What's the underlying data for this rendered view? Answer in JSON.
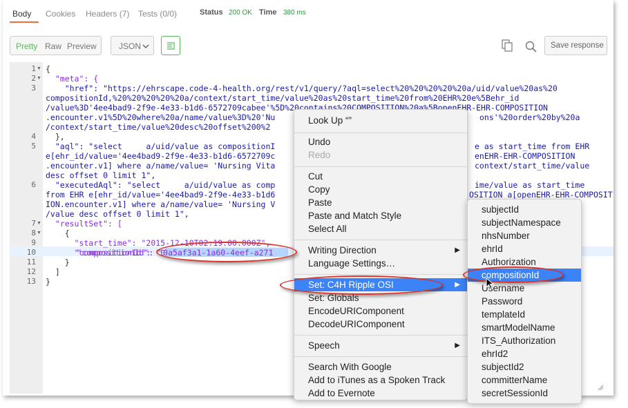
{
  "tabs": [
    {
      "label": "Body"
    },
    {
      "label": "Cookies"
    },
    {
      "label": "Headers (7)"
    },
    {
      "label": "Tests (0/0)"
    }
  ],
  "status": {
    "status_label": "Status",
    "status_value": "200 OK",
    "time_label": "Time",
    "time_value": "380 ms"
  },
  "toolbar": {
    "pretty": "Pretty",
    "raw": "Raw",
    "preview": "Preview",
    "format": "JSON",
    "save": "Save response"
  },
  "code_lines": [
    "{",
    "  \"meta\": {",
    "    \"href\": \"https://ehrscape.code-4-health.org/rest/v1/query/?aql=select%20%20%20%20%20a/uid/value%20as%20",
    "compositionId,%20%20%20%20%20a/context/start_time/value%20as%20start_time%20from%20EHR%20e%5Behr_id",
    "/value%3D'4ee4bad9-2f9e-4e33-b1d6-6572709cabee'%5D%20contains%20COMPOSITION%20a%5BopenEHR-EHR-COMPOSITION",
    ".encounter.v1%5D%20where%20a/name/value%3D%20'Nu",
    "/context/start_time/value%20desc%20offset%200%2",
    "  },",
    "  \"aql\": \"select     a/uid/value as compositionI",
    "e[ehr_id/value='4ee4bad9-2f9e-4e33-b1d6-6572709c",
    ".encounter.v1] where a/name/value= 'Nursing Vita",
    "desc offset 0 limit 1\",",
    "  \"executedAql\": \"select     a/uid/value as comp",
    "from EHR e[ehr_id/value='4ee4bad9-2f9e-4e33-b1d6",
    "ION.encounter.v1] where a/name/value= 'Nursing V",
    "/value desc offset 0 limit 1\",",
    "  \"resultSet\": [",
    "    {",
    "      \"start_time\": \"2015-12-10T02:19:00.000Z\",",
    "      \"compositionId\": \"0a5af3a1-1a60-4eef-a271",
    "    }",
    "  ]",
    "}"
  ],
  "code_right": [
    "ons'%20order%20by%20a",
    "e as start_time from EHR",
    "enEHR-EHR-COMPOSITION",
    "context/start_time/value",
    "ime/value as start_time",
    "OSITION a[openEHR-EHR-COMPOSIT"
  ],
  "line_numbers": [
    "1",
    "2",
    "3",
    "4",
    "5",
    "6",
    "7",
    "8",
    "9",
    "10",
    "11",
    "12",
    "13"
  ],
  "context_menu": {
    "items": [
      "Look Up “”",
      "Undo",
      "Redo",
      "Cut",
      "Copy",
      "Paste",
      "Paste and Match Style",
      "Select All",
      "Writing Direction",
      "Language Settings…",
      "Set: C4H Ripple OSI",
      "Set: Globals",
      "EncodeURIComponent",
      "DecodeURIComponent",
      "Speech",
      "Search With Google",
      "Add to iTunes as a Spoken Track",
      "Add to Evernote"
    ]
  },
  "submenu": {
    "items": [
      "subjectId",
      "subjectNamespace",
      "nhsNumber",
      "ehrId",
      "Authorization",
      "compositionId",
      "Username",
      "Password",
      "templateId",
      "smartModelName",
      "ITS_Authorization",
      "ehrId2",
      "subjectId2",
      "committerName",
      "secretSessionId"
    ]
  },
  "colors": {
    "accent": "#f26b3a",
    "status_ok": "#2a9a3a",
    "selection": "#3b83f7",
    "annotation": "#d9342b"
  }
}
